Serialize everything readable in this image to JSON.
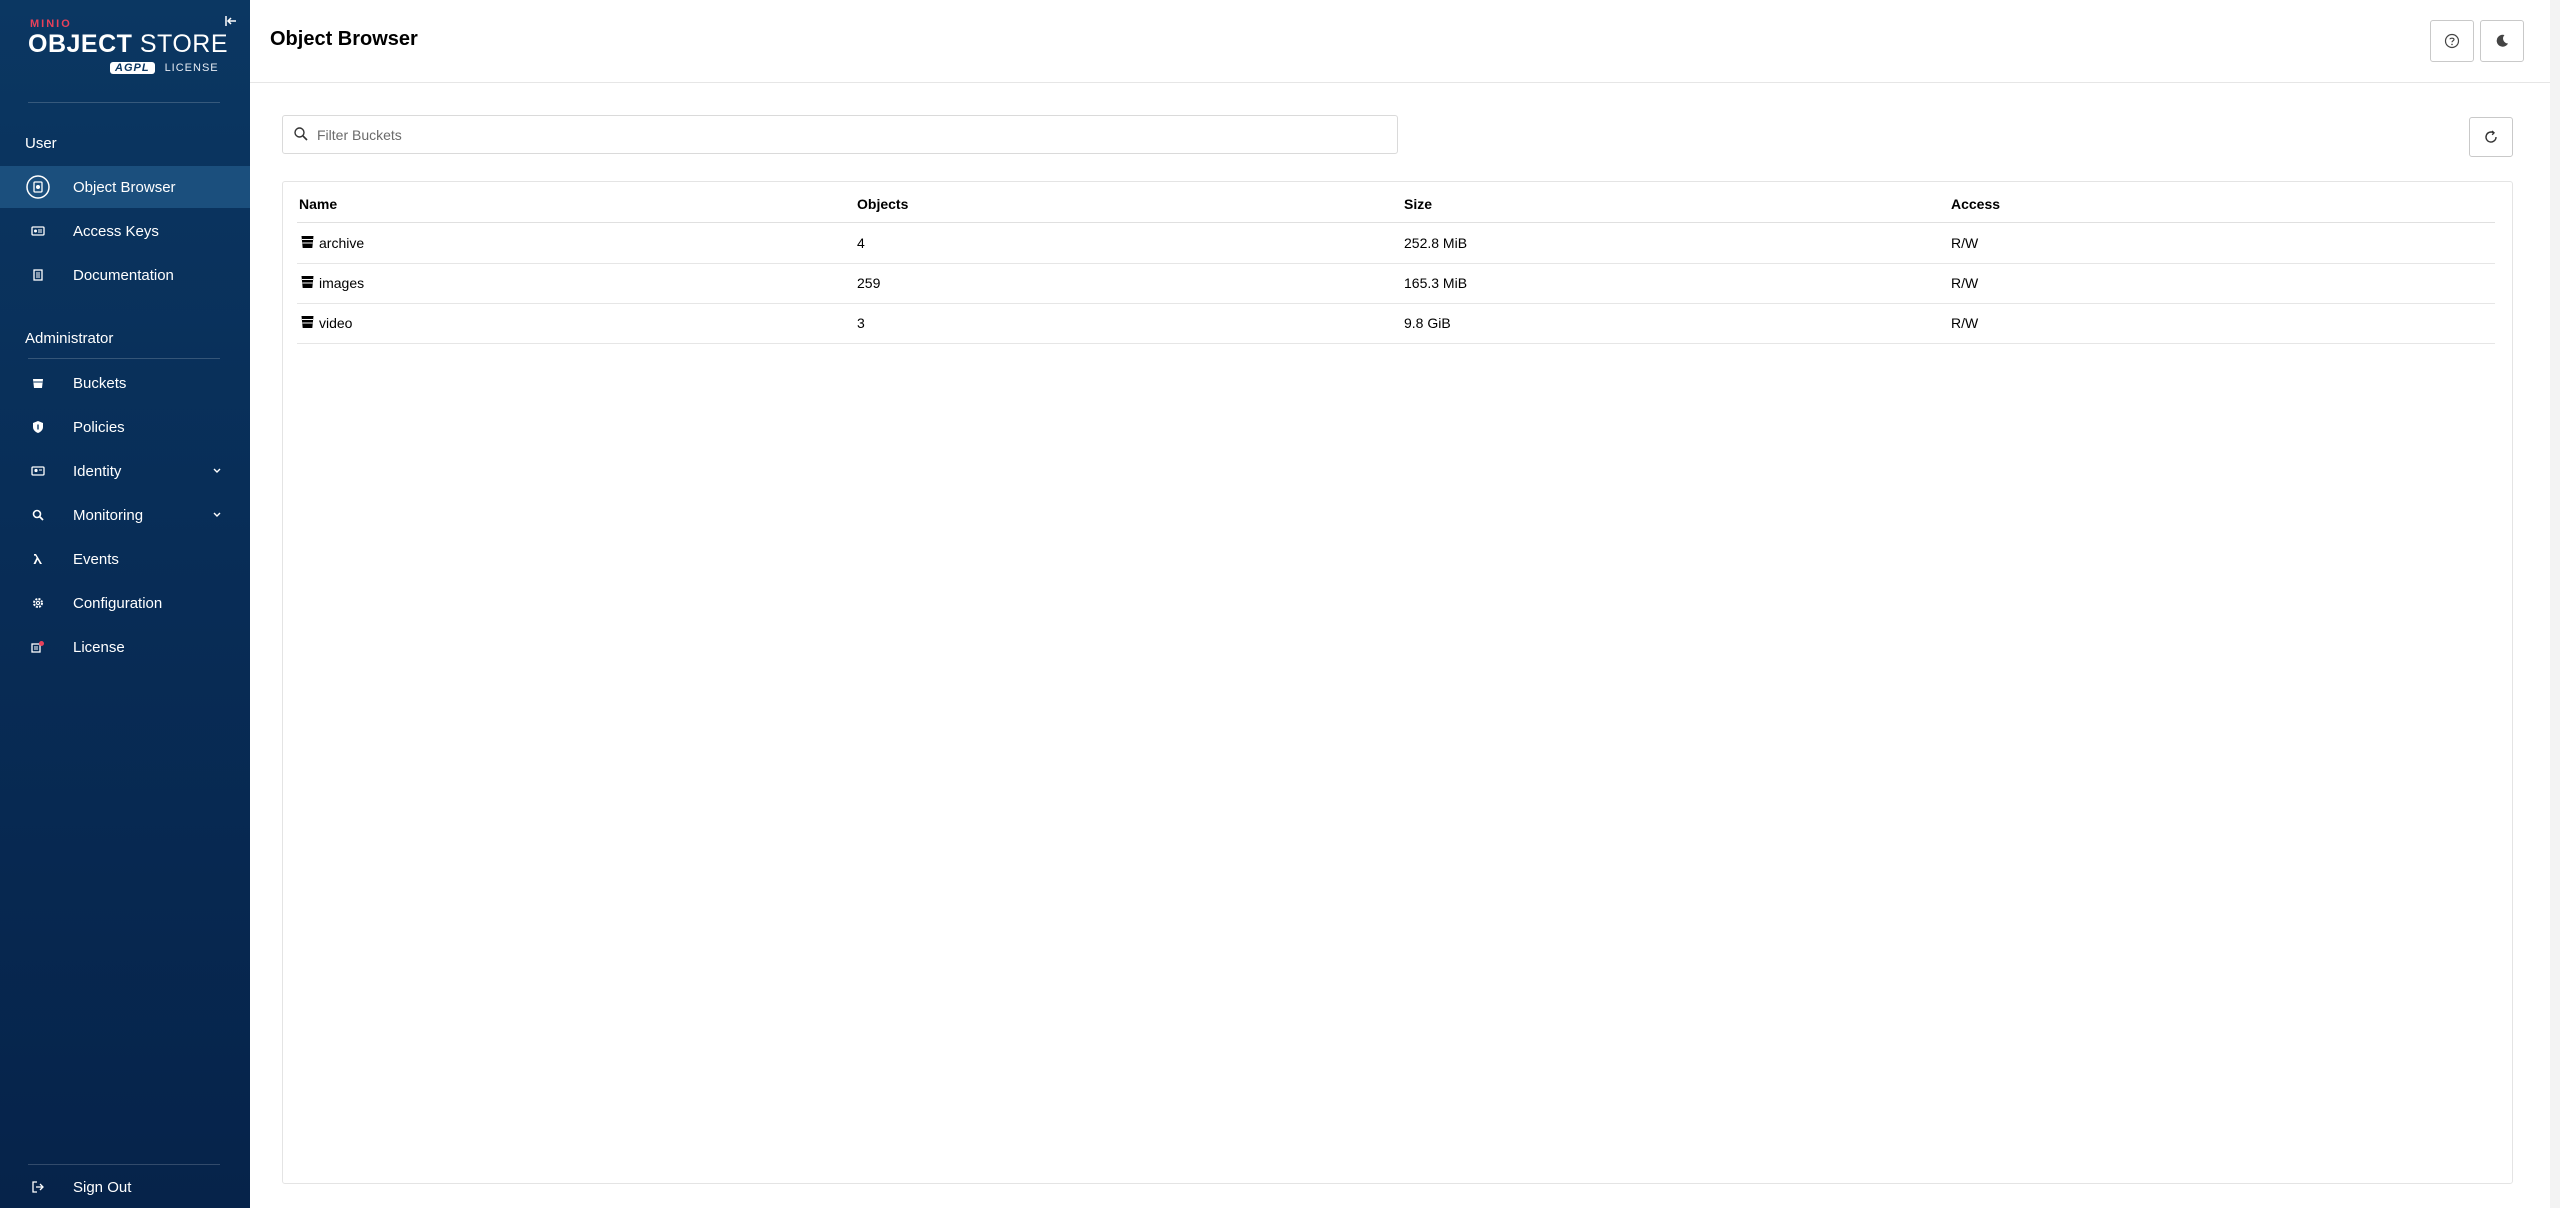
{
  "brand": {
    "small": "MINIO",
    "main_bold": "OBJECT",
    "main_light": " STORE",
    "license_badge": "AGPL",
    "license_text": "LICENSE"
  },
  "sidebar": {
    "user_section": "User",
    "user_items": [
      {
        "label": "Object Browser",
        "icon": "object-browser-icon"
      },
      {
        "label": "Access Keys",
        "icon": "access-keys-icon"
      },
      {
        "label": "Documentation",
        "icon": "documentation-icon"
      }
    ],
    "admin_section": "Administrator",
    "admin_items": [
      {
        "label": "Buckets",
        "icon": "bucket-icon"
      },
      {
        "label": "Policies",
        "icon": "shield-icon"
      },
      {
        "label": "Identity",
        "icon": "identity-icon"
      },
      {
        "label": "Monitoring",
        "icon": "monitoring-icon"
      },
      {
        "label": "Events",
        "icon": "lambda-icon"
      },
      {
        "label": "Configuration",
        "icon": "gear-icon"
      },
      {
        "label": "License",
        "icon": "license-icon"
      }
    ],
    "sign_out": "Sign Out"
  },
  "header": {
    "title": "Object Browser"
  },
  "search": {
    "placeholder": "Filter Buckets",
    "value": ""
  },
  "table": {
    "columns": [
      "Name",
      "Objects",
      "Size",
      "Access"
    ],
    "rows": [
      {
        "name": "archive",
        "objects": "4",
        "size": "252.8 MiB",
        "access": "R/W"
      },
      {
        "name": "images",
        "objects": "259",
        "size": "165.3 MiB",
        "access": "R/W"
      },
      {
        "name": "video",
        "objects": "3",
        "size": "9.8 GiB",
        "access": "R/W"
      }
    ]
  },
  "colors": {
    "sidebar_bg": "#0b3762",
    "active_item": "#1b4f7d",
    "brand_accent": "#e8415b"
  }
}
